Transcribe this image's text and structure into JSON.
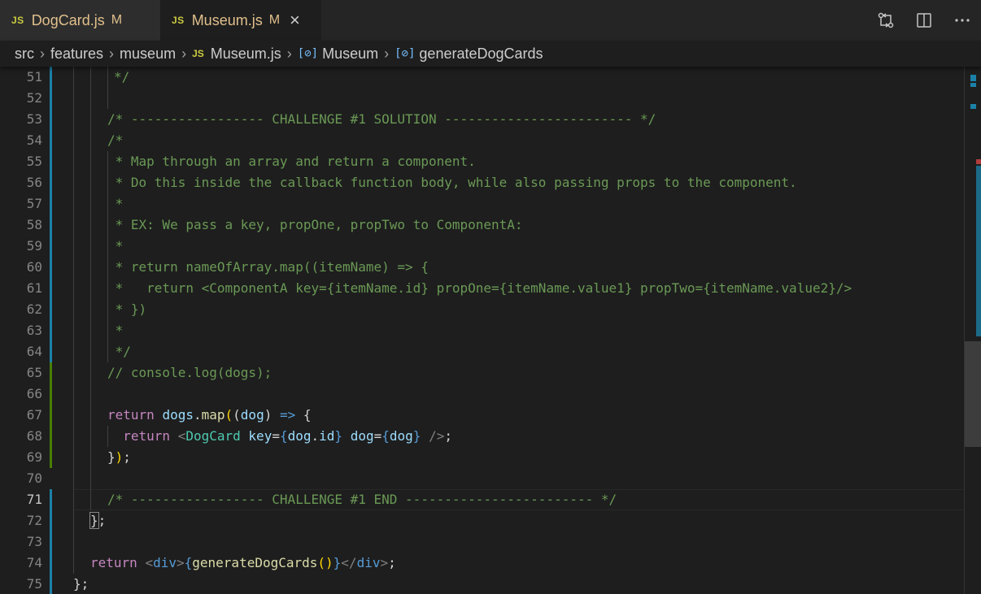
{
  "tabs": [
    {
      "label": "DogCard.js",
      "icon": "JS",
      "status": "M",
      "active": false
    },
    {
      "label": "Museum.js",
      "icon": "JS",
      "status": "M",
      "active": true,
      "close": "×"
    }
  ],
  "breadcrumb": {
    "items": [
      "src",
      "features",
      "museum",
      "Museum.js",
      "Museum",
      "generateDogCards"
    ],
    "separator": "›",
    "file_icon": "JS",
    "symbol_icon": "[⊘]"
  },
  "editor": {
    "current_line": 71,
    "lines": [
      {
        "n": "51",
        "text": "*/"
      },
      {
        "n": "52",
        "text": ""
      },
      {
        "n": "53",
        "text": "/* ----------------- CHALLENGE #1 SOLUTION ------------------------ */"
      },
      {
        "n": "54",
        "text": "/*"
      },
      {
        "n": "55",
        "text": " * Map through an array and return a component."
      },
      {
        "n": "56",
        "text": " * Do this inside the callback function body, while also passing props to the component."
      },
      {
        "n": "57",
        "text": " *"
      },
      {
        "n": "58",
        "text": " * EX: We pass a key, propOne, propTwo to ComponentA:"
      },
      {
        "n": "59",
        "text": " *"
      },
      {
        "n": "60",
        "text": " * return nameOfArray.map((itemName) => {"
      },
      {
        "n": "61",
        "text": " *   return <ComponentA key={itemName.id} propOne={itemName.value1} propTwo={itemName.value2}/>"
      },
      {
        "n": "62",
        "text": " * })"
      },
      {
        "n": "63",
        "text": " *"
      },
      {
        "n": "64",
        "text": " */"
      },
      {
        "n": "65",
        "text": "// console.log(dogs);"
      },
      {
        "n": "66",
        "text": ""
      },
      {
        "n": "67",
        "text": "return dogs.map((dog) => {"
      },
      {
        "n": "68",
        "text": "  return <DogCard key={dog.id} dog={dog} />;"
      },
      {
        "n": "69",
        "text": "});"
      },
      {
        "n": "70",
        "text": ""
      },
      {
        "n": "71",
        "text": "/* ----------------- CHALLENGE #1 END ------------------------ */"
      },
      {
        "n": "72",
        "text": "};"
      },
      {
        "n": "73",
        "text": ""
      },
      {
        "n": "74",
        "text": "return <div>{generateDogCards()}</div>;"
      },
      {
        "n": "75",
        "text": "};"
      }
    ]
  },
  "colors": {
    "background": "#1e1e1e",
    "comment": "#6a9955",
    "keyword": "#c586c0",
    "variable": "#9cdcfe",
    "function": "#dcdcaa",
    "tag": "#4ec9b0",
    "modified_gutter": "#1b81a8",
    "added_gutter": "#487e02",
    "tab_modified": "#e2c08d"
  },
  "icons": [
    "open-changes-icon",
    "split-editor-icon",
    "more-actions-icon",
    "close-icon",
    "symbol-icon"
  ]
}
